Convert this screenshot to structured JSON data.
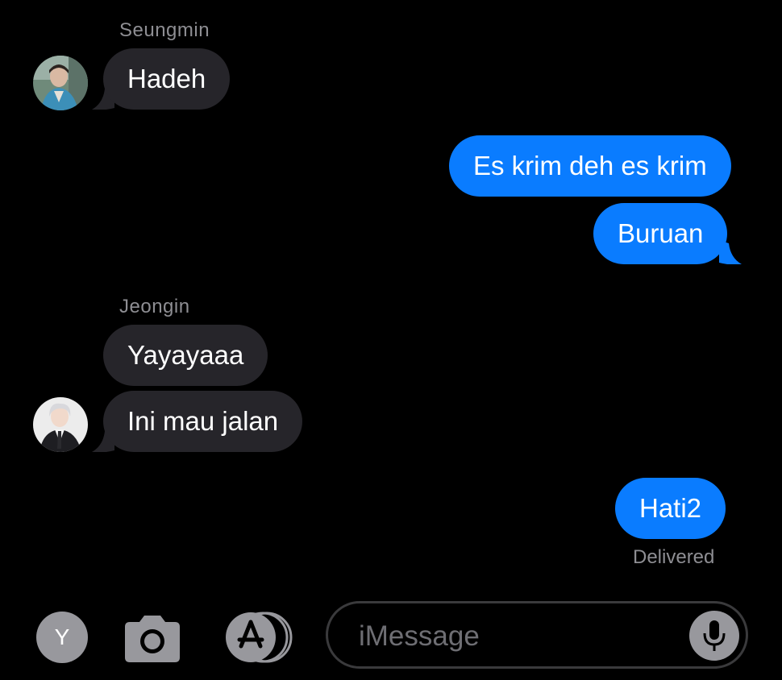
{
  "conversation": {
    "groups": [
      {
        "sender": "Seungmin",
        "messages": [
          "Hadeh"
        ]
      },
      {
        "sender": "me",
        "messages": [
          "Es krim deh es krim",
          "Buruan"
        ]
      },
      {
        "sender": "Jeongin",
        "messages": [
          "Yayayaaa",
          "Ini mau jalan"
        ]
      },
      {
        "sender": "me",
        "messages": [
          "Hati2"
        ]
      }
    ],
    "status": "Delivered"
  },
  "toolbar": {
    "profile_initial": "Y",
    "camera_icon": "camera-icon",
    "appstore_icon": "appstore-icon"
  },
  "composer": {
    "placeholder": "iMessage",
    "mic_icon": "microphone-icon"
  },
  "colors": {
    "background": "#000000",
    "incoming_bubble": "#26252a",
    "outgoing_bubble": "#0a7cff",
    "secondary_text": "#8e8e93"
  }
}
